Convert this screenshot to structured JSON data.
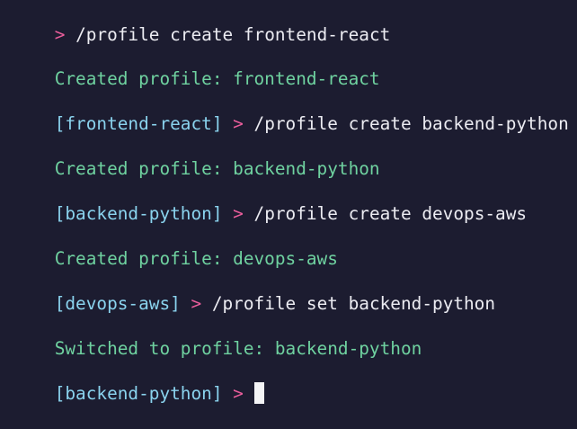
{
  "terminal": {
    "lines": [
      {
        "kind": "input",
        "tag": "",
        "arrow": ">",
        "command": " /profile create frontend-react"
      },
      {
        "kind": "output",
        "text": "Created profile: frontend-react"
      },
      {
        "kind": "input",
        "tag": "[frontend-react]",
        "arrow": " >",
        "command": " /profile create backend-python"
      },
      {
        "kind": "output",
        "text": "Created profile: backend-python"
      },
      {
        "kind": "input",
        "tag": "[backend-python]",
        "arrow": " >",
        "command": " /profile create devops-aws"
      },
      {
        "kind": "output",
        "text": "Created profile: devops-aws"
      },
      {
        "kind": "input",
        "tag": "[devops-aws]",
        "arrow": " >",
        "command": " /profile set backend-python"
      },
      {
        "kind": "output",
        "text": "Switched to profile: backend-python"
      },
      {
        "kind": "input",
        "tag": "[backend-python]",
        "arrow": " >",
        "command": " "
      }
    ],
    "colors": {
      "background": "#1c1c30",
      "prompt_arrow": "#ea5d9b",
      "profile_tag": "#8ad3ee",
      "command": "#ececf2",
      "output": "#6fd2a0",
      "cursor": "#f4f4f6"
    }
  }
}
